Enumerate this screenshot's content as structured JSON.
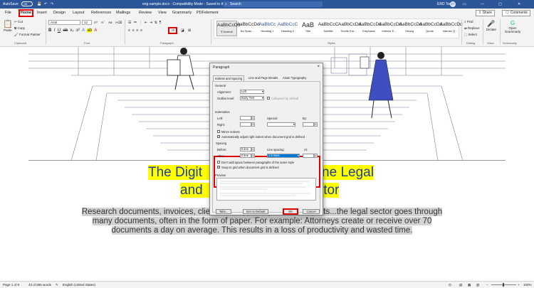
{
  "titlebar": {
    "autosave_label": "AutoSave",
    "autosave_state": "Off",
    "doc_title": "eng-sample.docx  -  Compatibility Mode  -  Saved to this PC",
    "search_placeholder": "Search",
    "user_name": "ERD Tool",
    "user_initials": "ET"
  },
  "tabs": [
    "File",
    "Home",
    "Insert",
    "Design",
    "Layout",
    "References",
    "Mailings",
    "Review",
    "View",
    "Grammarly",
    "PDFelement"
  ],
  "tab_actions": {
    "share": "Share",
    "comments": "Comments"
  },
  "ribbon": {
    "clipboard": {
      "paste": "Paste",
      "cut": "Cut",
      "copy": "Copy",
      "format_painter": "Format Painter",
      "group": "Clipboard"
    },
    "font": {
      "font_name": "Arial",
      "font_size": "12",
      "group": "Font"
    },
    "paragraph": {
      "group": "Paragraph"
    },
    "styles": {
      "group": "Styles",
      "items": [
        {
          "sample": "AaBbCcDd",
          "name": "¶ Normal"
        },
        {
          "sample": "AaBbCcDd",
          "name": "No Spac..."
        },
        {
          "sample": "AaBbCc",
          "name": "Heading 1"
        },
        {
          "sample": "AaBbCcC",
          "name": "Heading 2"
        },
        {
          "sample": "AaB",
          "name": "Title"
        },
        {
          "sample": "AaBbCcC",
          "name": "Subtitle"
        },
        {
          "sample": "AaBbCcDd",
          "name": "Subtle Em..."
        },
        {
          "sample": "AaBbCcDd",
          "name": "Emphasis"
        },
        {
          "sample": "AaBbCcDd",
          "name": "Intense E..."
        },
        {
          "sample": "AaBbCcDd",
          "name": "Strong"
        },
        {
          "sample": "AaBbCcDd",
          "name": "Quote"
        },
        {
          "sample": "AaBbCcDd",
          "name": "Intense Q..."
        }
      ]
    },
    "editing": {
      "find": "Find",
      "replace": "Replace",
      "select": "Select",
      "group": "Editing"
    },
    "voice": {
      "dictate": "Dictate",
      "group": "Voice"
    },
    "grammarly": {
      "open": "Open Grammarly",
      "group": "Grammarly"
    }
  },
  "document": {
    "heading_line1_a": "The Digit",
    "heading_line1_b": "ne Legal",
    "heading_line2_a": "and",
    "heading_line2_b": "ctor",
    "body_a": "Research documents, invoices, client files, opposing counsel reports...the legal sector goes through many documents, often in the form of paper. For example: Attorneys create or receive over 70 documents a day on average. This results in a loss of productivity and wasted time."
  },
  "dialog": {
    "title": "Paragraph",
    "tabs": [
      "Indents and Spacing",
      "Line and Page Breaks",
      "Asian Typography"
    ],
    "general": {
      "label": "General",
      "alignment_label": "Alignment:",
      "alignment_value": "Left",
      "outline_label": "Outline level:",
      "outline_value": "Body Text",
      "collapsed_label": "Collapsed by default"
    },
    "indentation": {
      "label": "Indentation",
      "left_label": "Left:",
      "right_label": "Right:",
      "special_label": "Special:",
      "by_label": "By:",
      "mirror_label": "Mirror indents",
      "auto_adjust_label": "Automatically adjust right indent when document grid is defined"
    },
    "spacing": {
      "label": "Spacing",
      "before_label": "Before:",
      "before_value": "0 line",
      "after_label": "After:",
      "after_value": "0 line",
      "line_spacing_label": "Line spacing:",
      "line_spacing_value": "1.5 lines",
      "at_label": "At:",
      "dont_add_label": "Don't add space between paragraphs of the same style",
      "snap_label": "Snap to grid when document grid is defined"
    },
    "preview_label": "Preview",
    "buttons": {
      "tabs": "Tabs...",
      "set_default": "Set As Default",
      "ok": "OK",
      "cancel": "Cancel"
    }
  },
  "statusbar": {
    "page": "Page 1 of 8",
    "words": "43 of 555 words",
    "language": "English (United States)",
    "zoom": "100%"
  }
}
